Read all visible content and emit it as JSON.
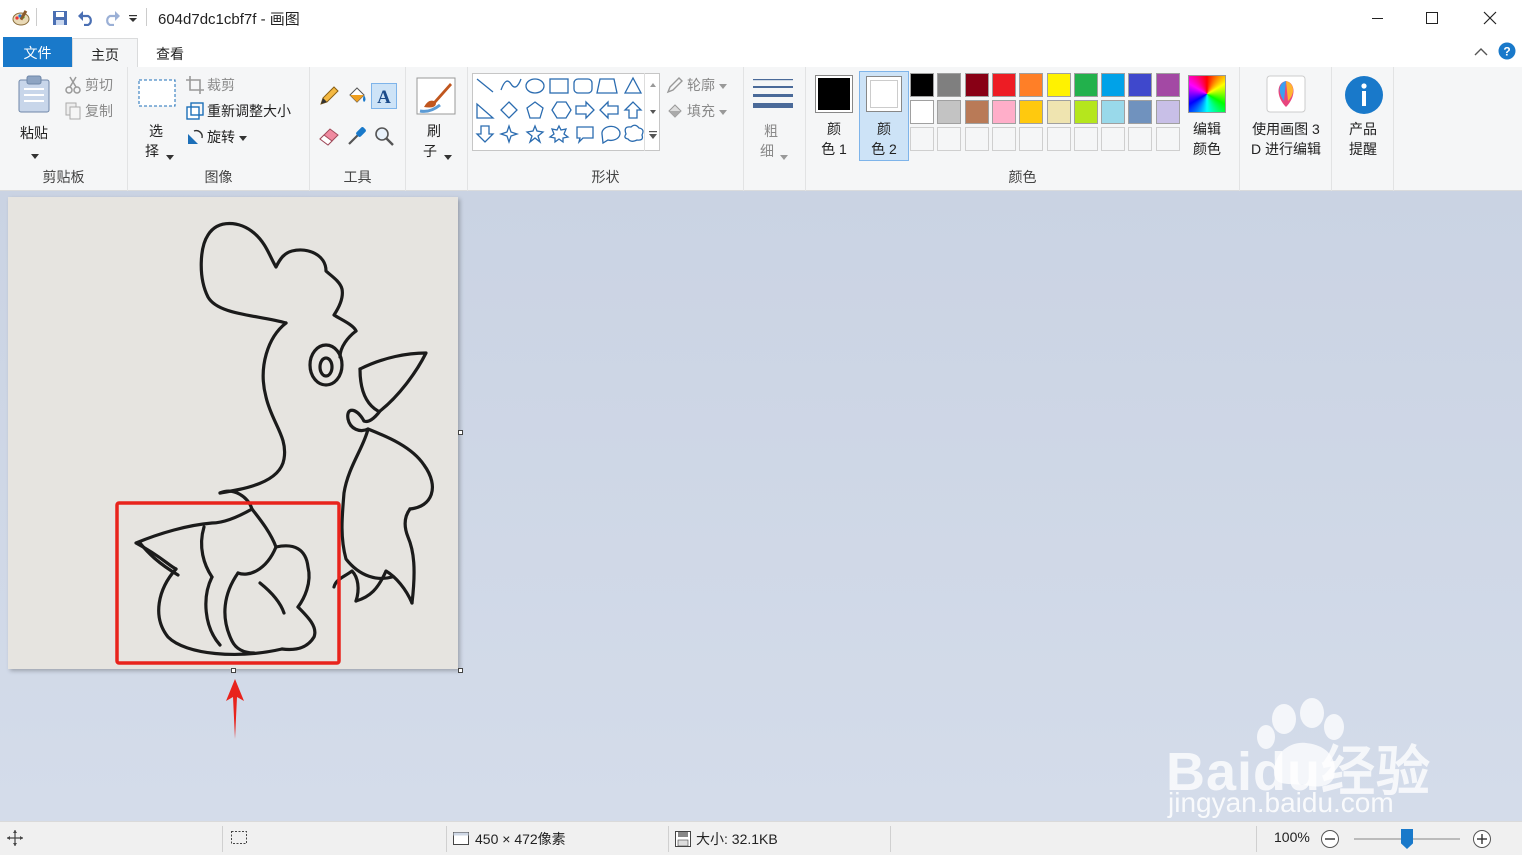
{
  "window": {
    "title": "604d7dc1cbf7f - 画图"
  },
  "tabs": {
    "file": "文件",
    "home": "主页",
    "view": "查看"
  },
  "clipboard": {
    "paste": "粘贴",
    "cut": "剪切",
    "copy": "复制",
    "label": "剪贴板"
  },
  "image": {
    "select_line1": "选",
    "select_line2": "择",
    "crop": "裁剪",
    "resize": "重新调整大小",
    "rotate": "旋转",
    "label": "图像"
  },
  "tools": {
    "label": "工具"
  },
  "brushes": {
    "line1": "刷",
    "line2": "子"
  },
  "shapes": {
    "outline": "轮廓",
    "fill": "填充",
    "label": "形状"
  },
  "size": {
    "line1": "粗",
    "line2": "细"
  },
  "colors": {
    "color1_line1": "颜",
    "color1_line2": "色 1",
    "color2_line1": "颜",
    "color2_line2": "色 2",
    "edit_line1": "编辑",
    "edit_line2": "颜色",
    "paint3d_line1": "使用画图 3",
    "paint3d_line2": "D 进行编辑",
    "alert_line1": "产品",
    "alert_line2": "提醒",
    "label": "颜色",
    "color1_value": "#000000",
    "color2_value": "#ffffff",
    "palette_row1": [
      "#000000",
      "#7f7f7f",
      "#880015",
      "#ed1c24",
      "#ff7f27",
      "#fff200",
      "#22b14c",
      "#00a2e8",
      "#3f48cc",
      "#a349a4"
    ],
    "palette_row2": [
      "#ffffff",
      "#c3c3c3",
      "#b97a57",
      "#ffaec9",
      "#ffc90e",
      "#efe4b0",
      "#b5e61d",
      "#99d9ea",
      "#7092be",
      "#c8bfe7"
    ]
  },
  "status": {
    "dimensions": "450 × 472像素",
    "filesize": "大小: 32.1KB",
    "zoom": "100%"
  },
  "watermark": {
    "brand": "Baidu经验",
    "url": "jingyan.baidu.com"
  }
}
